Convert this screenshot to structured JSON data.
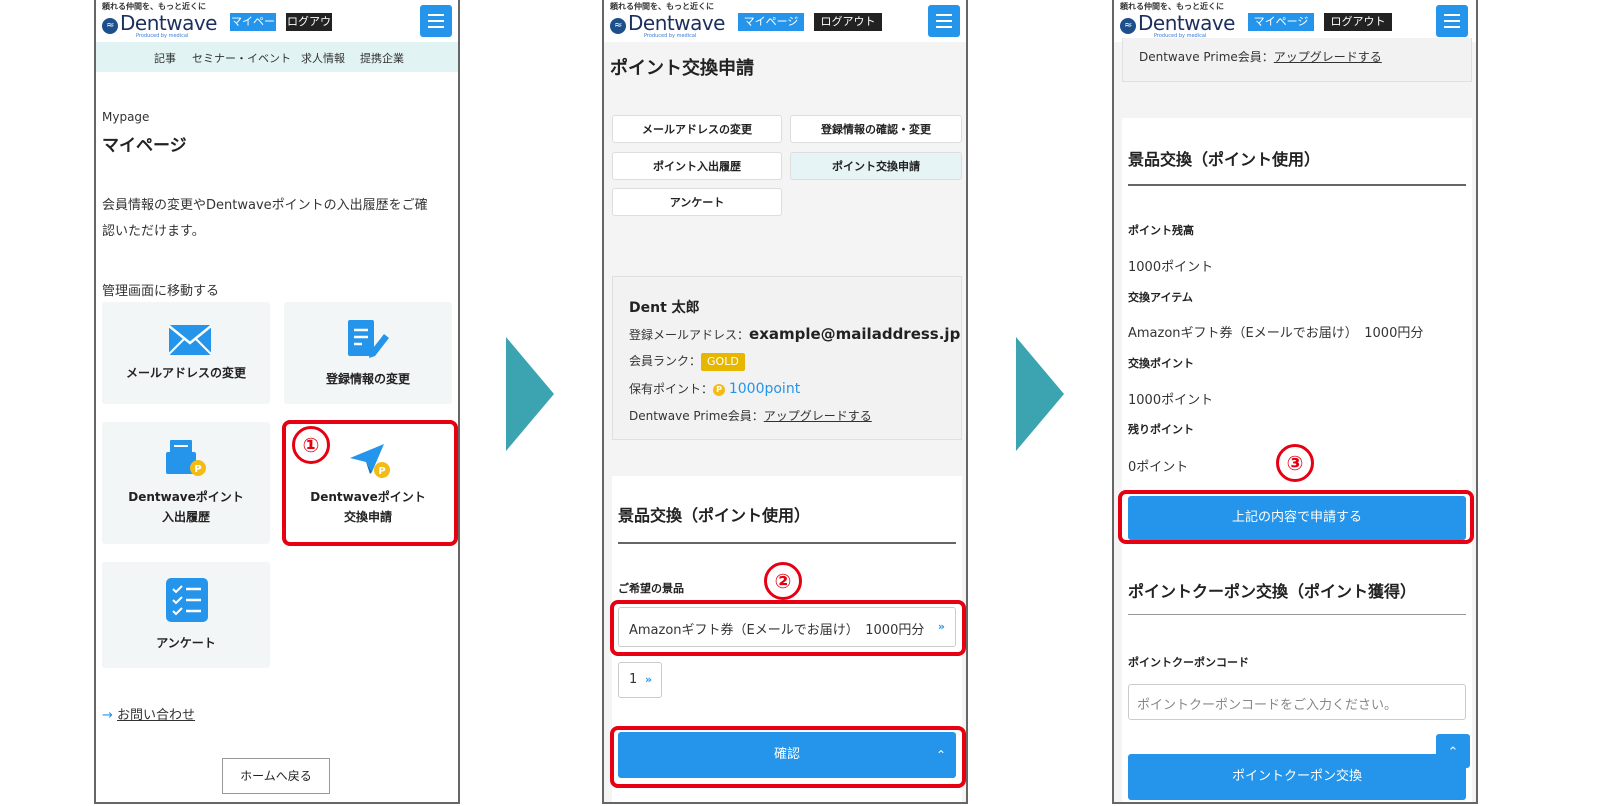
{
  "header": {
    "tagline": "頼れる仲間を、もっと近くに",
    "brand": "Dentwave",
    "produced_by": "Produced by medical",
    "mypage_button": "マイページ",
    "logout_button": "ログアウト"
  },
  "nav": {
    "items": [
      "記事",
      "セミナー・イベント",
      "求人情報",
      "提携企業"
    ]
  },
  "screen1": {
    "eyebrow": "Mypage",
    "title": "マイページ",
    "desc_line1": "会員情報の変更やDentwaveポイントの入出履歴をご確",
    "desc_line2": "認いただけます。",
    "admin_heading": "管理画面に移動する",
    "cards": {
      "email": "メールアドレスの変更",
      "registration": "登録情報の変更",
      "history_l1": "Dentwaveポイント",
      "history_l2": "入出履歴",
      "exchange_l1": "Dentwaveポイント",
      "exchange_l2": "交換申請",
      "survey": "アンケート"
    },
    "contact_link": "お問い合わせ",
    "home_button": "ホームへ戻る",
    "step_number": "①"
  },
  "screen2": {
    "title": "ポイント交換申請",
    "menu": {
      "email": "メールアドレスの変更",
      "registration": "登録情報の確認・変更",
      "history": "ポイント入出履歴",
      "exchange": "ポイント交換申請",
      "survey": "アンケート"
    },
    "profile": {
      "name": "Dent 太郎",
      "email_label": "登録メールアドレス：",
      "email_value": "example@mailaddress.jp",
      "rank_label": "会員ランク：",
      "rank_value": "GOLD",
      "points_label": "保有ポイント：",
      "coin_glyph": "P",
      "points_value": "1000point",
      "prime_label": "Dentwave Prime会員：",
      "prime_link": "アップグレードする"
    },
    "exchange_heading": "景品交換（ポイント使用）",
    "prize_label": "ご希望の景品",
    "prize_select": "Amazonギフト券（Eメールでお届け）　1000円分",
    "quantity": "1",
    "confirm_button": "確認",
    "step_number": "②"
  },
  "screen3": {
    "prime_label": "Dentwave Prime会員：",
    "prime_link": "アップグレードする",
    "exchange_heading": "景品交換（ポイント使用）",
    "balance_label": "ポイント残高",
    "balance_value": "1000ポイント",
    "item_label": "交換アイテム",
    "item_value": "Amazonギフト券（Eメールでお届け）　1000円分",
    "exchange_points_label": "交換ポイント",
    "exchange_points_value": "1000ポイント",
    "remaining_label": "残りポイント",
    "remaining_value": "0ポイント",
    "submit_button": "上記の内容で申請する",
    "coupon_heading": "ポイントクーポン交換（ポイント獲得）",
    "coupon_label": "ポイントクーポンコード",
    "coupon_placeholder": "ポイントクーポンコードをご入力ください。",
    "coupon_button": "ポイントクーポン交換",
    "step_number": "③"
  },
  "colors": {
    "accent_blue": "#2495ea",
    "highlight_red": "#e60012",
    "arrow_teal": "#3ca3b0",
    "gold": "#e7b700"
  }
}
